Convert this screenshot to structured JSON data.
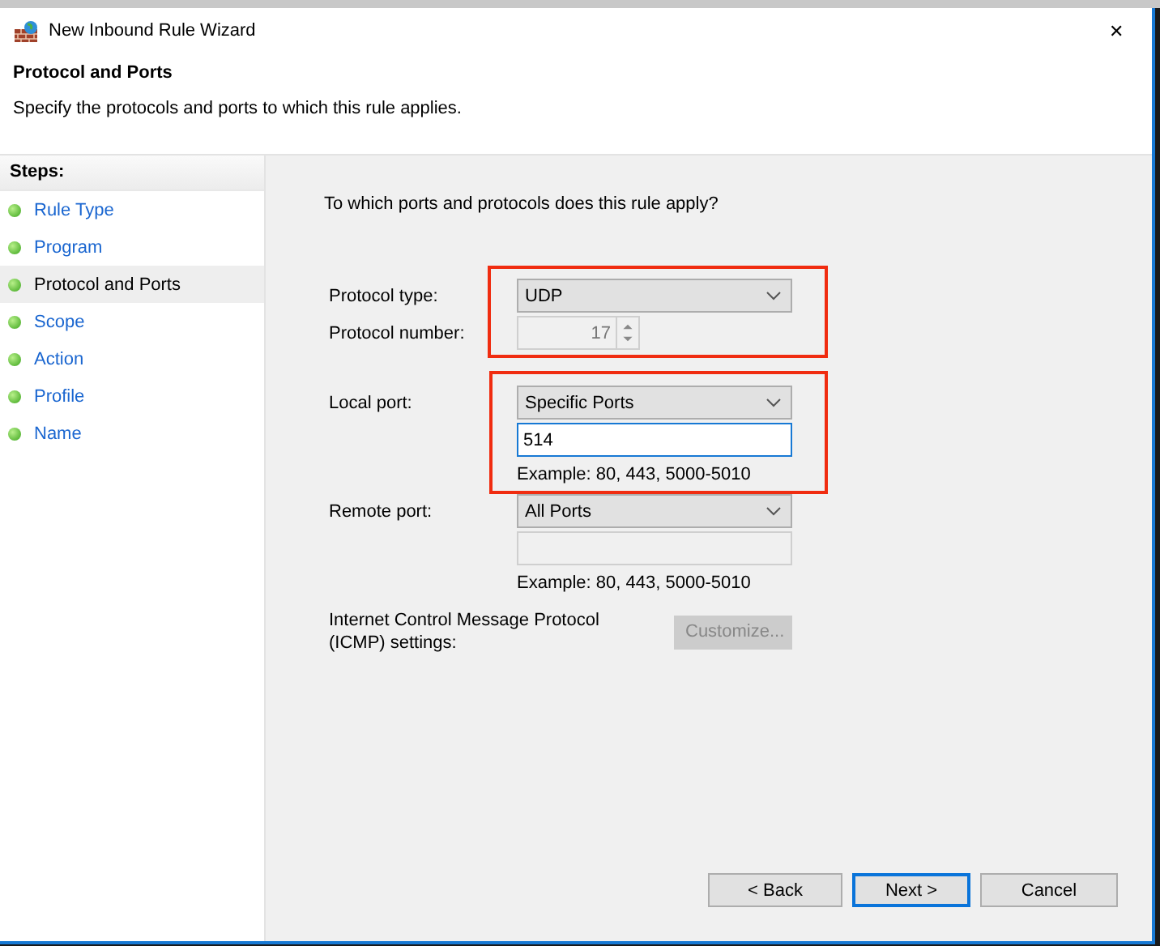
{
  "window": {
    "title": "New Inbound Rule Wizard",
    "close": "✕"
  },
  "header": {
    "title": "Protocol and Ports",
    "subtitle": "Specify the protocols and ports to which this rule applies."
  },
  "steps": {
    "heading": "Steps:",
    "items": [
      {
        "label": "Rule Type",
        "selected": false
      },
      {
        "label": "Program",
        "selected": false
      },
      {
        "label": "Protocol and Ports",
        "selected": true
      },
      {
        "label": "Scope",
        "selected": false
      },
      {
        "label": "Action",
        "selected": false
      },
      {
        "label": "Profile",
        "selected": false
      },
      {
        "label": "Name",
        "selected": false
      }
    ]
  },
  "form": {
    "question": "To which ports and protocols does this rule apply?",
    "protocol_type": {
      "label": "Protocol type:",
      "value": "UDP"
    },
    "protocol_number": {
      "label": "Protocol number:",
      "value": "17",
      "disabled": true
    },
    "local_port": {
      "label": "Local port:",
      "value": "Specific Ports",
      "ports": "514",
      "disabled": false,
      "example": "Example: 80, 443, 5000-5010"
    },
    "remote_port": {
      "label": "Remote port:",
      "value": "All Ports",
      "disabled": true,
      "example": "Example: 80, 443, 5000-5010"
    },
    "icmp": {
      "label": "Internet Control Message Protocol (ICMP) settings:",
      "button": "Customize...",
      "disabled": true
    }
  },
  "buttons": [
    {
      "label": "< Back",
      "selected": false
    },
    {
      "label": "Next >",
      "selected": true
    },
    {
      "label": "Cancel",
      "selected": false
    }
  ]
}
